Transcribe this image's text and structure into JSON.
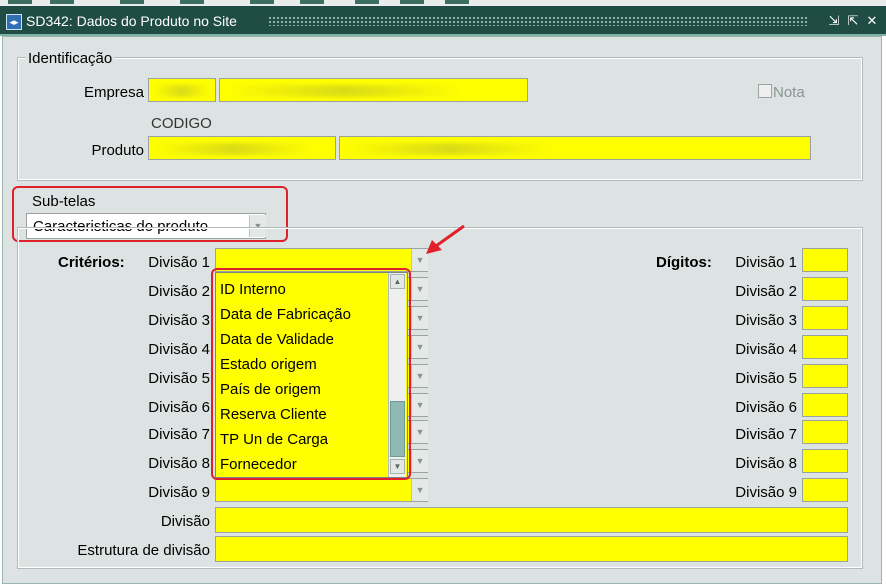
{
  "window": {
    "title": "SD342: Dados do Produto no Site",
    "icon": "app-window-icon",
    "controls": [
      "minimize-icon",
      "restore-icon",
      "close-icon"
    ]
  },
  "identificacao": {
    "group_label": "Identificação",
    "empresa_label": "Empresa",
    "empresa_code": "",
    "empresa_name": "",
    "nota_label": "Nota",
    "nota_checked": false,
    "codigo_caption": "CODIGO",
    "produto_label": "Produto",
    "produto_code": "",
    "produto_name": ""
  },
  "subtelas": {
    "label": "Sub-telas",
    "selected": "Caracteristicas do produto"
  },
  "criterios": {
    "label": "Critérios:",
    "divisoes": [
      "Divisão 1",
      "Divisão 2",
      "Divisão 3",
      "Divisão 4",
      "Divisão 5",
      "Divisão 6",
      "Divisão 7",
      "Divisão 8",
      "Divisão 9"
    ],
    "dropdown_open_options": [
      "ID Interno",
      "Data de Fabricação",
      "Data de Validade",
      "Estado origem",
      "País de origem",
      "Reserva  Cliente",
      "TP  Un de Carga",
      "Fornecedor"
    ]
  },
  "digitos": {
    "label": "Dígitos:",
    "divisoes": [
      "Divisão 1",
      "Divisão 2",
      "Divisão 3",
      "Divisão 4",
      "Divisão 5",
      "Divisão 6",
      "Divisão 7",
      "Divisão 8",
      "Divisão 9"
    ]
  },
  "footer_fields": {
    "divisao_label": "Divisão",
    "divisao_value": "",
    "estrutura_label": "Estrutura de divisão",
    "estrutura_value": ""
  },
  "colors": {
    "titlebar": "#1f4d45",
    "field_fill": "#ffff00",
    "highlight": "#e0202a",
    "panel": "#dde3e2"
  }
}
